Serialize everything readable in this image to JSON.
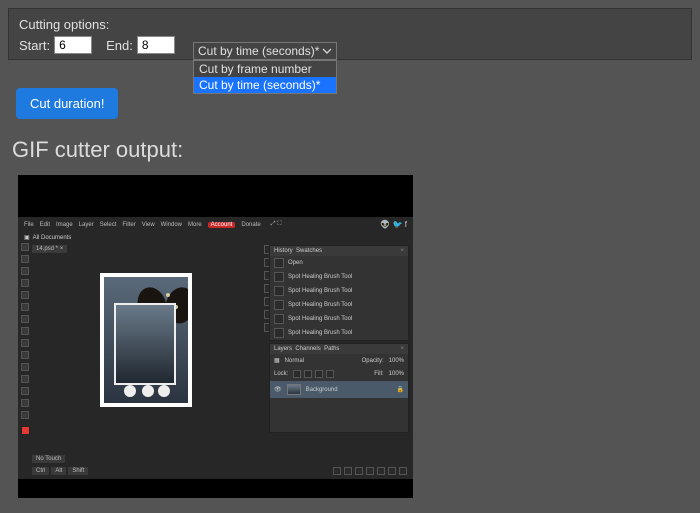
{
  "cutting": {
    "title": "Cutting options:",
    "start_label": "Start:",
    "start_value": "6",
    "end_label": "End:",
    "end_value": "8",
    "select_display": "Cut by time (seconds)*",
    "options": [
      "Cut by frame number",
      "Cut by time (seconds)*"
    ],
    "selected_index": 1,
    "button": "Cut duration!"
  },
  "output_heading": "GIF cutter output:",
  "editor": {
    "menus": [
      "File",
      "Edit",
      "Image",
      "Layer",
      "Select",
      "Filter",
      "View",
      "Window",
      "More"
    ],
    "account": "Account",
    "donate": "Donate",
    "all_documents": "All Documents",
    "tab": "14.psd *",
    "history_panel": {
      "tabs": [
        "History",
        "Swatches"
      ],
      "first": "Open",
      "items": [
        "Spot Healing Brush Tool",
        "Spot Healing Brush Tool",
        "Spot Healing Brush Tool",
        "Spot Healing Brush Tool",
        "Spot Healing Brush Tool"
      ]
    },
    "layers_panel": {
      "tabs": [
        "Layers",
        "Channels",
        "Paths"
      ],
      "blend": "Normal",
      "opacity_label": "Opacity:",
      "opacity": "100%",
      "lock_label": "Lock:",
      "fill_label": "Fill:",
      "fill": "100%",
      "bg": "Background"
    },
    "footer": {
      "ctrl": "Ctrl",
      "alt": "Alt",
      "shift": "Shift",
      "notouch": "No Touch"
    }
  }
}
